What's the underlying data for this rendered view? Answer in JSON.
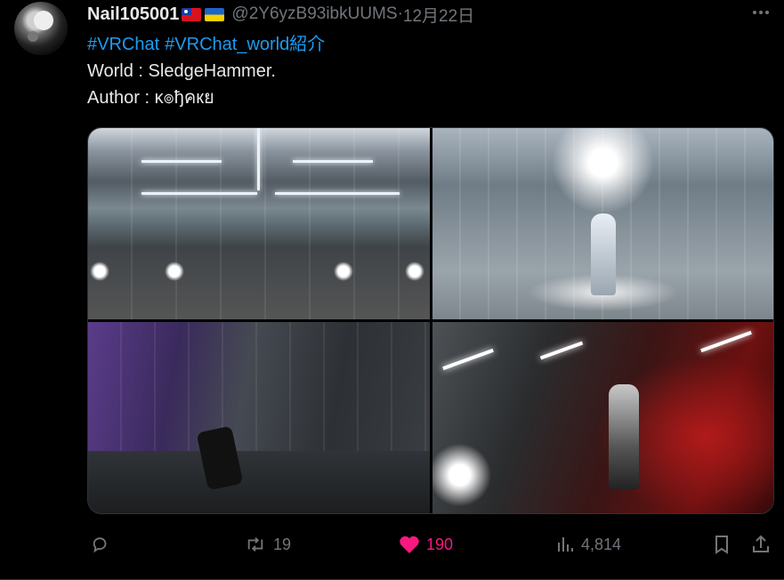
{
  "tweet": {
    "author_name": "Nail105001",
    "flags": [
      "taiwan-flag",
      "ukraine-flag"
    ],
    "handle": "@2Y6yzB93ibkUUMS",
    "separator": " · ",
    "date": "12月22日",
    "hashtags": [
      "#VRChat",
      "#VRChat_world紹介"
    ],
    "text_lines": [
      "World : SledgeHammer.",
      "Author : κ๏ђคкย"
    ],
    "media_count": 4,
    "stats": {
      "replies": "",
      "reposts": "19",
      "likes": "190",
      "views": "4,814"
    }
  },
  "colors": {
    "accent": "#1d9bf0",
    "like": "#f91880",
    "secondary": "#71767b",
    "text": "#e7e9ea",
    "background": "#000000"
  },
  "icons": {
    "more": "more-horizontal-icon",
    "reply": "reply-icon",
    "repost": "repost-icon",
    "like": "heart-icon",
    "views": "views-chart-icon",
    "bookmark": "bookmark-icon",
    "share": "share-icon"
  }
}
